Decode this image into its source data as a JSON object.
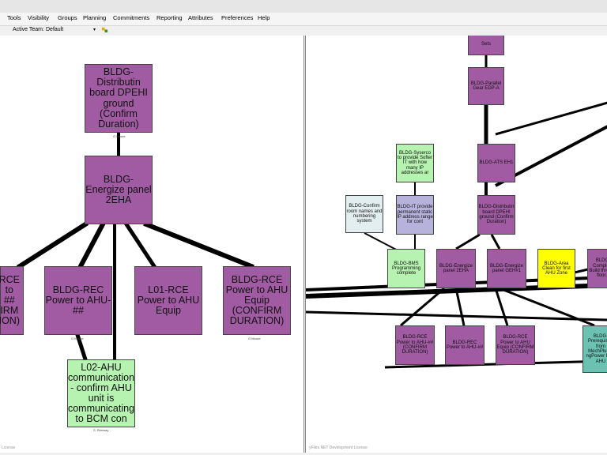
{
  "menu": [
    "Tools",
    "Visibility",
    "Groups",
    "Planning",
    "Commitments",
    "Reporting",
    "Attributes",
    "Preferences",
    "Help"
  ],
  "toolbar": {
    "team_label": "Active Team:",
    "team_value": "Default",
    "dropdown_glyph": "▾"
  },
  "left": {
    "top_box": "BLDG-Distributin board DPEHI ground (Confirm Duration)",
    "mid_box": "BLDG-Energize panel 2EHA",
    "box_a": "RCE\nto\n##\nIRM\nION)",
    "box_b": "BLDG-REC Power to AHU-##",
    "box_c": "L01-RCE Power to AHU Equip",
    "box_d": "BLDG-RCE Power to AHU Equip (CONFIRM DURATION)",
    "green_box": "L02-AHU communication - confirm AHU unit is communicating to BCM con",
    "lbl_more1": "G Moore",
    "lbl_more2": "G Moore",
    "lbl_more3": "G Moore",
    "lbl_renway": "S. Renway",
    "license": "License"
  },
  "right": {
    "r_sets": "Sets",
    "r_parallel": "BLDG-Parallel Gear EDP-A",
    "r_sys": "BLDG-Syserco to provide Softer IT with how many IP addresses ar",
    "r_ats": "BLDG-ATS EH1",
    "r_confirm": "BLDG-Confirm room names and numbering system",
    "r_it": "BLDG-IT provide permanent static IP address range for cont",
    "r_dist": "BLDG-Distributin board DPEHI ground (Confirm Duration)",
    "r_bms": "BLDG-BMS Programming complete",
    "r_energ2": "BLDG-Energize panel 2EHA",
    "r_energq": "BLDG-Energize panel GEH#1",
    "r_area": "BLDG-Area Clean for first AHU Zone",
    "r_comp": "BLDG-Complete Build through floor...",
    "r_rce1": "BLDG-RCE Power to AHU-## (CONFIRM DURATION)",
    "r_rec": "BLDG-REC Power to AHU-##",
    "r_rce2": "BLDG-RCE Power to AHU Equip (CONFIRM DURATION)",
    "r_prereq": "BLDG-Prerequisite from MechPlumb ngPower First AHU",
    "license": "yFiles.NET Development License"
  }
}
